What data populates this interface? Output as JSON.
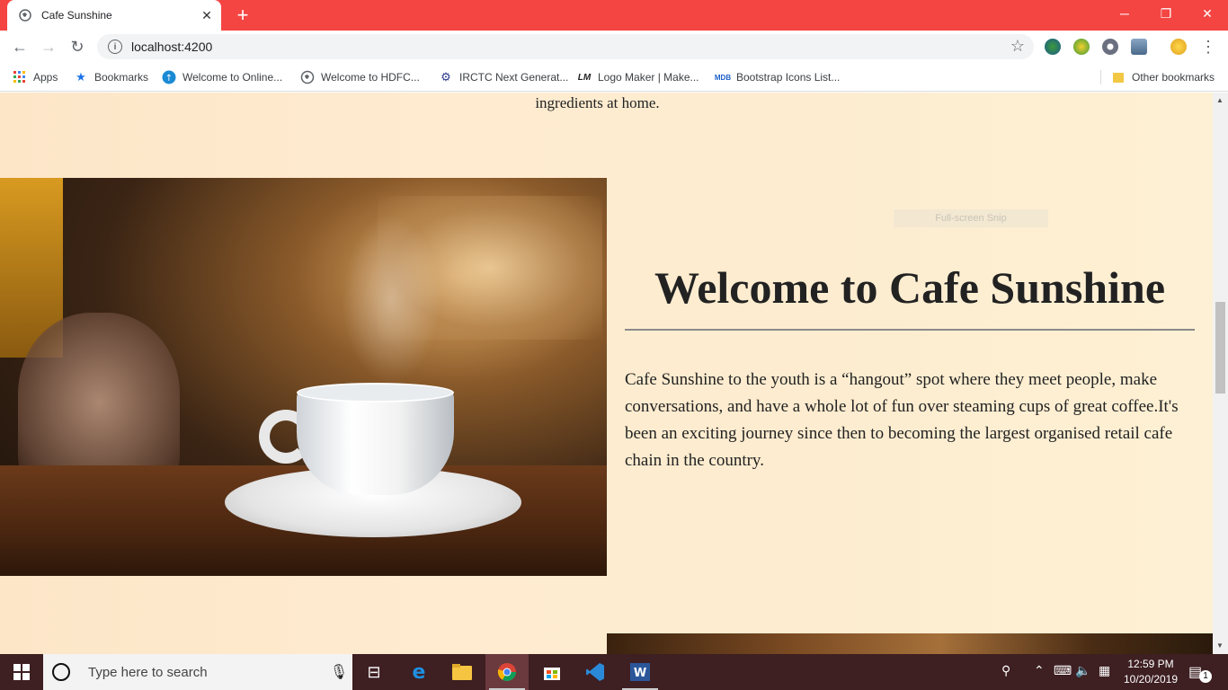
{
  "browser": {
    "tab_title": "Cafe Sunshine",
    "url": "localhost:4200",
    "bookmarks": [
      {
        "label": "Apps",
        "icon": "apps-grid-icon"
      },
      {
        "label": "Bookmarks",
        "icon": "star-icon"
      },
      {
        "label": "Welcome to Online...",
        "icon": "globe-icon"
      },
      {
        "label": "Welcome to HDFC...",
        "icon": "globe-icon"
      },
      {
        "label": "IRCTC Next Generat...",
        "icon": "irctc-icon"
      },
      {
        "label": "Logo Maker | Make...",
        "icon": "lm-icon"
      },
      {
        "label": "Bootstrap Icons List...",
        "icon": "mdb-icon"
      },
      {
        "label": "Other bookmarks",
        "icon": "folder-icon"
      }
    ]
  },
  "page": {
    "top_text": "ingredients at home.",
    "snip_label": "Full-screen Snip",
    "welcome_title": "Welcome to Cafe Sunshine",
    "welcome_text": "Cafe Sunshine to the youth is a “hangout” spot where they meet people, make conversations, and have a whole lot of fun over steaming cups of great coffee.It's been an exciting journey since then to becoming the largest organised retail cafe chain in the country."
  },
  "taskbar": {
    "search_placeholder": "Type here to search",
    "time": "12:59 PM",
    "date": "10/20/2019",
    "notification_count": "1"
  },
  "colors": {
    "chrome_accent": "#f44543",
    "page_background": "#fdeccf",
    "taskbar": "#3e1f22"
  }
}
